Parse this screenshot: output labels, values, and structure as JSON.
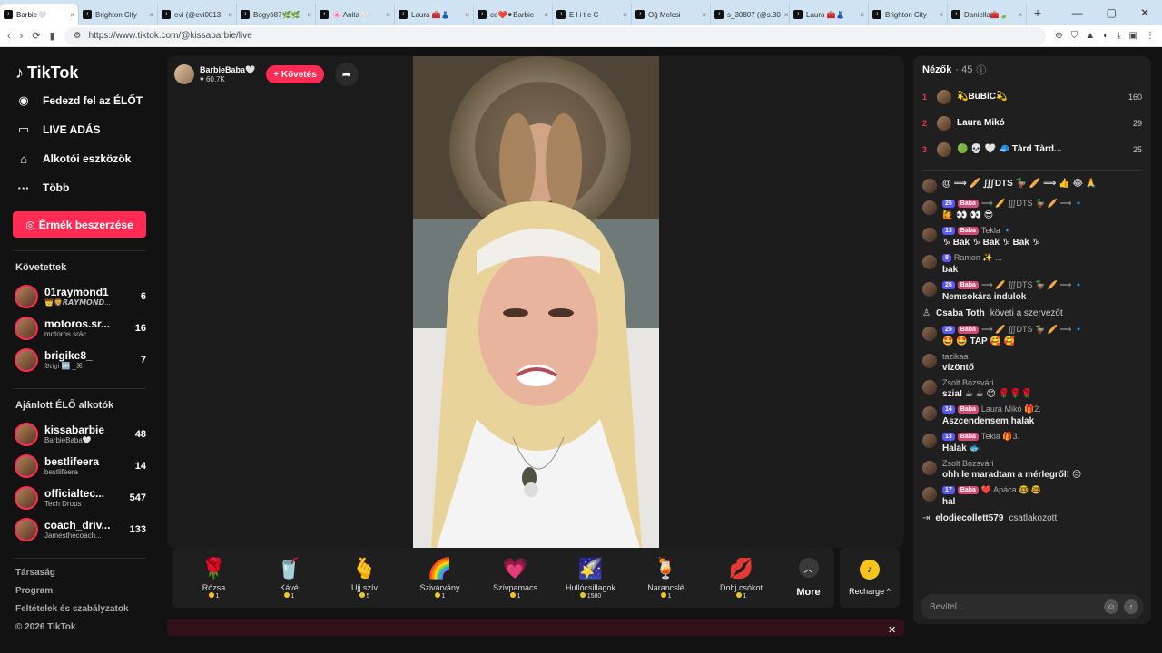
{
  "browser": {
    "tabs": [
      {
        "title": "Barbie🤍",
        "active": true
      },
      {
        "title": "Brighton City"
      },
      {
        "title": "evi (@evi0013"
      },
      {
        "title": "Bogyó87🌿🌿"
      },
      {
        "title": "🌸 Anita 🤍"
      },
      {
        "title": "Laura 🧰👗"
      },
      {
        "title": "ce❤️⚫Barbie"
      },
      {
        "title": "E l i t e C"
      },
      {
        "title": "Oğ Melcsi"
      },
      {
        "title": "s_30807 (@s.30"
      },
      {
        "title": "Laura 🧰👗"
      },
      {
        "title": "Brighton City"
      },
      {
        "title": "Daniella🧰🍃"
      }
    ],
    "new_tab": "+",
    "url": "https://www.tiktok.com/@kissabarbie/live"
  },
  "sidebar": {
    "logo": "TikTok",
    "nav": [
      {
        "label": "Fedezd fel az ÉLŐT",
        "icon": "live-explore-icon"
      },
      {
        "label": "LIVE ADÁS",
        "icon": "camera-icon"
      },
      {
        "label": "Alkotói eszközök",
        "icon": "creator-tools-icon"
      },
      {
        "label": "Több",
        "icon": "more-dots-icon"
      }
    ],
    "coins_button": "Érmék beszerzése",
    "followed_title": "Követettek",
    "followed": [
      {
        "name": "01raymond1",
        "sub": "👑🦁𝙍𝘼𝙔𝙈𝙊𝙉𝘿...",
        "count": "6"
      },
      {
        "name": "motoros.sr...",
        "sub": "motoros srác",
        "count": "16"
      },
      {
        "name": "brigike8_",
        "sub": "𝔅𝔯𝔦𝔤𝔦 🆙 _ꕤ",
        "count": "7"
      }
    ],
    "suggested_title": "Ajánlott ÉLŐ alkotók",
    "suggested": [
      {
        "name": "kissabarbie",
        "sub": "BarbieBaba🤍",
        "count": "48"
      },
      {
        "name": "bestlifeera",
        "sub": "bestlifeera",
        "count": "14"
      },
      {
        "name": "officialtec...",
        "sub": "Tech Drops",
        "count": "547"
      },
      {
        "name": "coach_driv...",
        "sub": "Jamesthecoach...",
        "count": "133"
      }
    ],
    "footer": [
      "Társaság",
      "Program",
      "Feltételek és szabályzatok",
      "© 2026 TikTok"
    ]
  },
  "host": {
    "name": "BarbieBaba🤍",
    "likes": "60.7K",
    "follow_label": "+ Követés"
  },
  "gifts": [
    {
      "icon": "🌹",
      "name": "Rózsa",
      "price": "1"
    },
    {
      "icon": "🥤",
      "name": "Kávé",
      "price": "1"
    },
    {
      "icon": "🫰",
      "name": "Ujj szív",
      "price": "5"
    },
    {
      "icon": "🌈",
      "name": "Szivárvány",
      "price": "1"
    },
    {
      "icon": "💗",
      "name": "Szívpamacs",
      "price": "1"
    },
    {
      "icon": "🌠",
      "name": "Hullócsillagok",
      "price": "1580"
    },
    {
      "icon": "🍹",
      "name": "Narancslé",
      "price": "1"
    },
    {
      "icon": "💋",
      "name": "Dobj csókot",
      "price": "1"
    }
  ],
  "more_label": "More",
  "recharge_label": "Recharge ^",
  "chat": {
    "viewers_title": "Nézők",
    "viewers_count": "· 45",
    "top_viewers": [
      {
        "rank": "1",
        "name": "💫BuBiC💫",
        "score": "160"
      },
      {
        "rank": "2",
        "name": "Laura Mikó",
        "score": "29"
      },
      {
        "rank": "3",
        "name": "🟢 💀 🤍 🧢 Tàrd Tàrd...",
        "score": "25"
      }
    ],
    "messages": [
      {
        "level": "",
        "fan": "",
        "name": "",
        "text": "@ ⟹ 🥖 ∭DTS 🦆 🥖 ⟹ 👍 😂 🙏"
      },
      {
        "level": "25",
        "fan": "Baba",
        "name": "⟹ 🥖 ∭DTS 🦆 🥖 ⟹ 🔹",
        "text": "🙋 👀 👀 😎"
      },
      {
        "level": "13",
        "fan": "Baba",
        "name": "Tekla 🔹",
        "text": "♑ Bak ♑ Bak ♑ Bak ♑"
      },
      {
        "level": "8",
        "fan": "",
        "name": "Ramon ✨ ...",
        "text": "bak"
      },
      {
        "level": "25",
        "fan": "Baba",
        "name": "⟹ 🥖 ∭DTS 🦆 🥖 ⟹ 🔹",
        "text": "Nemsokára indulok"
      },
      {
        "level": "25",
        "fan": "Baba",
        "name": "⟹ 🥖 ∭DTS 🦆 🥖 ⟹ 🔹",
        "text": "🤩 🤩 TAP 🥰 🥰"
      },
      {
        "level": "",
        "fan": "",
        "name": "tazikaa",
        "text": "vízöntő"
      },
      {
        "level": "",
        "fan": "",
        "name": "Zsolt Bózsvári",
        "text": "szia! ☕ ☕ 😊 🌹🌹🌹"
      },
      {
        "level": "14",
        "fan": "Baba",
        "name": "Laura Mikó 🎁2.",
        "text": "Aszcendensem halak"
      },
      {
        "level": "13",
        "fan": "Baba",
        "name": "Tekla 🎁3.",
        "text": "Halak 🐟"
      },
      {
        "level": "",
        "fan": "",
        "name": "Zsolt Bózsvári",
        "text": "ohh le maradtam a mérlegről! 😔"
      },
      {
        "level": "17",
        "fan": "Baba",
        "name": "❤️ Apáca 🤓 🤓",
        "text": "hal"
      }
    ],
    "system_follow": {
      "name": "Csaba Toth",
      "text": "követi a szervezőt"
    },
    "system_join": {
      "name": "elodiecollett579",
      "text": "csatlakozott"
    },
    "input_placeholder": "Bevitel..."
  }
}
